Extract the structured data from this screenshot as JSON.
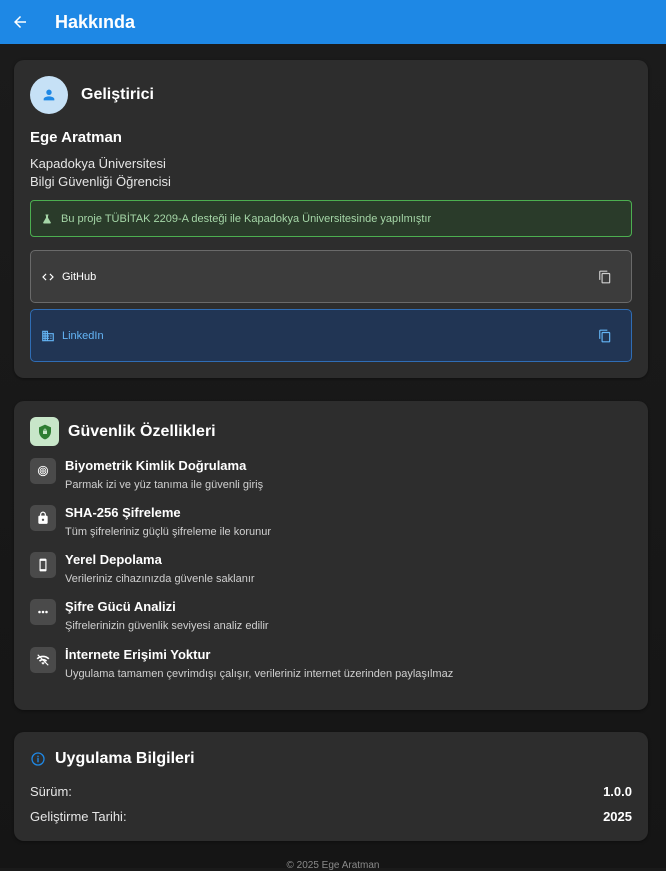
{
  "appbar": {
    "title": "Hakkında",
    "back_icon": "arrow-back-icon"
  },
  "developer": {
    "section_title": "Geliştirici",
    "name": "Ege Aratman",
    "line1": "Kapadokya Üniversitesi",
    "line2": "Bilgi Güvenliği Öğrencisi",
    "support_note": "Bu proje TÜBİTAK 2209-A desteği ile Kapadokya Üniversitesinde yapılmıştır",
    "links": [
      {
        "label": "GitHub",
        "icon": "code-icon",
        "action_icon": "copy-icon"
      },
      {
        "label": "LinkedIn",
        "icon": "business-icon",
        "action_icon": "copy-icon"
      }
    ]
  },
  "security": {
    "section_title": "Güvenlik Özellikleri",
    "features": [
      {
        "title": "Biyometrik Kimlik Doğrulama",
        "desc": "Parmak izi ve yüz tanıma ile güvenli giriş",
        "icon": "fingerprint-icon"
      },
      {
        "title": "SHA-256 Şifreleme",
        "desc": "Tüm şifreleriniz güçlü şifreleme ile korunur",
        "icon": "lock-icon"
      },
      {
        "title": "Yerel Depolama",
        "desc": "Verileriniz cihazınızda güvenle saklanır",
        "icon": "phone-icon"
      },
      {
        "title": "Şifre Gücü Analizi",
        "desc": "Şifrelerinizin güvenlik seviyesi analiz edilir",
        "icon": "password-dots-icon"
      },
      {
        "title": "İnternete Erişimi Yoktur",
        "desc": "Uygulama tamamen çevrimdışı çalışır, verileriniz internet üzerinden paylaşılmaz",
        "icon": "wifi-off-icon"
      }
    ]
  },
  "app_info": {
    "section_title": "Uygulama Bilgileri",
    "rows": [
      {
        "key": "Sürüm:",
        "value": "1.0.0"
      },
      {
        "key": "Geliştirme Tarihi:",
        "value": "2025"
      }
    ]
  },
  "footer": {
    "text": "© 2025 Ege Aratman"
  },
  "colors": {
    "primary": "#1e88e5",
    "success": "#4caf50",
    "link": "#64b5f6"
  }
}
